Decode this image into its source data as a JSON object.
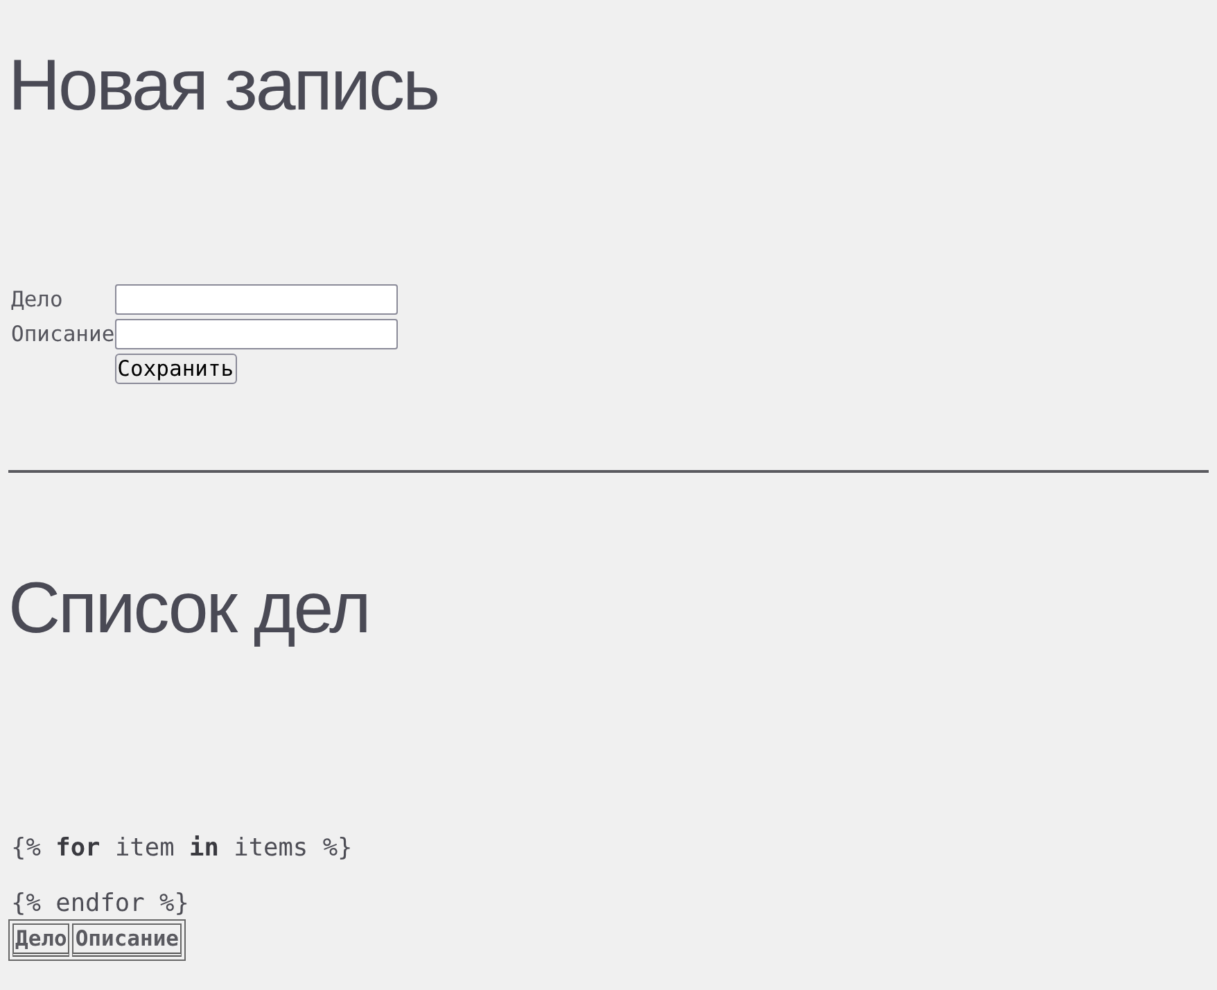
{
  "form": {
    "heading": "Новая запись",
    "fields": [
      {
        "label": "Дело"
      },
      {
        "label": "Описание"
      }
    ],
    "submit": "Сохранить"
  },
  "list": {
    "heading": "Список дел",
    "template_lines": [
      "{% **for** item **in** items %}",
      "{% endfor %}"
    ],
    "table": {
      "columns": [
        "Дело",
        "Описание"
      ]
    }
  }
}
